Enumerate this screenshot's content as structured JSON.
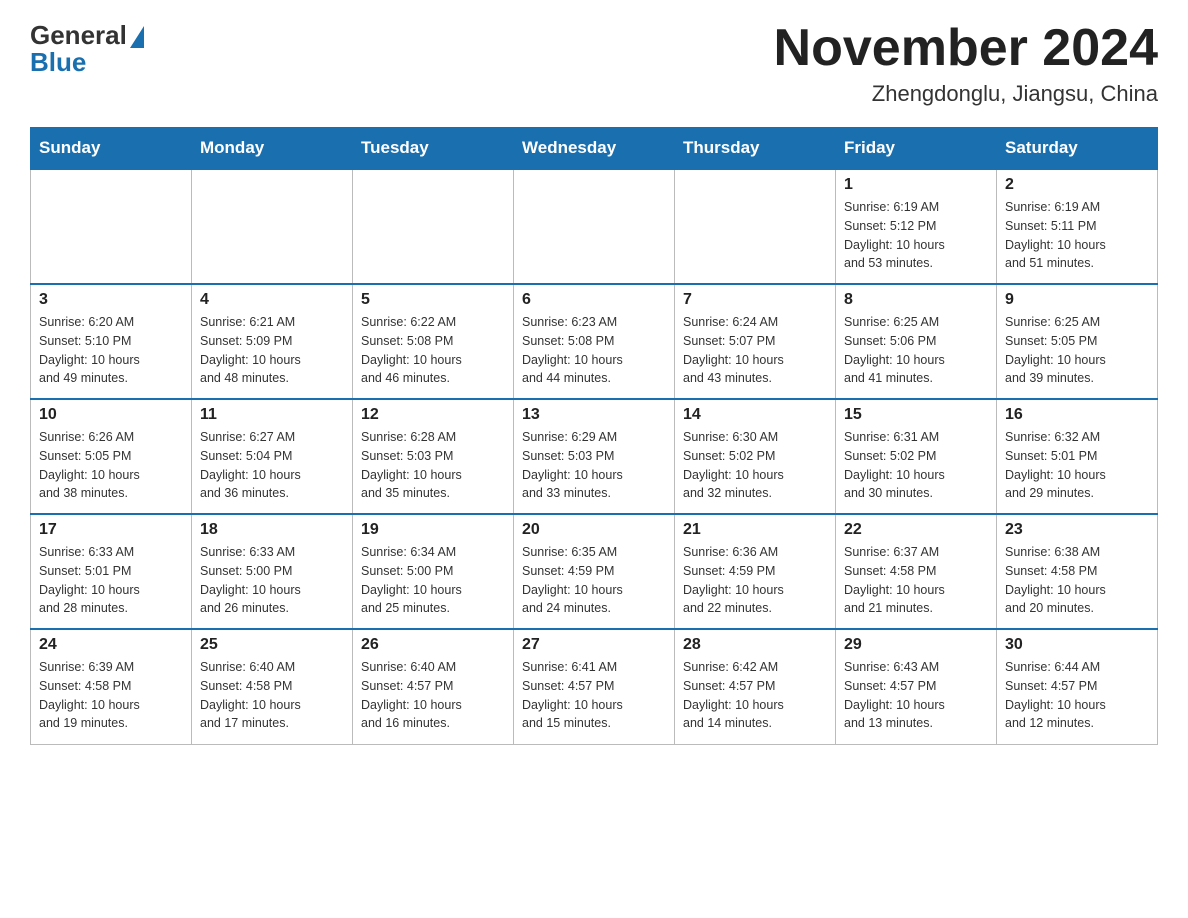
{
  "header": {
    "logo_general": "General",
    "logo_blue": "Blue",
    "month_title": "November 2024",
    "location": "Zhengdonglu, Jiangsu, China"
  },
  "days_of_week": [
    "Sunday",
    "Monday",
    "Tuesday",
    "Wednesday",
    "Thursday",
    "Friday",
    "Saturday"
  ],
  "weeks": [
    [
      {
        "day": "",
        "info": ""
      },
      {
        "day": "",
        "info": ""
      },
      {
        "day": "",
        "info": ""
      },
      {
        "day": "",
        "info": ""
      },
      {
        "day": "",
        "info": ""
      },
      {
        "day": "1",
        "info": "Sunrise: 6:19 AM\nSunset: 5:12 PM\nDaylight: 10 hours\nand 53 minutes."
      },
      {
        "day": "2",
        "info": "Sunrise: 6:19 AM\nSunset: 5:11 PM\nDaylight: 10 hours\nand 51 minutes."
      }
    ],
    [
      {
        "day": "3",
        "info": "Sunrise: 6:20 AM\nSunset: 5:10 PM\nDaylight: 10 hours\nand 49 minutes."
      },
      {
        "day": "4",
        "info": "Sunrise: 6:21 AM\nSunset: 5:09 PM\nDaylight: 10 hours\nand 48 minutes."
      },
      {
        "day": "5",
        "info": "Sunrise: 6:22 AM\nSunset: 5:08 PM\nDaylight: 10 hours\nand 46 minutes."
      },
      {
        "day": "6",
        "info": "Sunrise: 6:23 AM\nSunset: 5:08 PM\nDaylight: 10 hours\nand 44 minutes."
      },
      {
        "day": "7",
        "info": "Sunrise: 6:24 AM\nSunset: 5:07 PM\nDaylight: 10 hours\nand 43 minutes."
      },
      {
        "day": "8",
        "info": "Sunrise: 6:25 AM\nSunset: 5:06 PM\nDaylight: 10 hours\nand 41 minutes."
      },
      {
        "day": "9",
        "info": "Sunrise: 6:25 AM\nSunset: 5:05 PM\nDaylight: 10 hours\nand 39 minutes."
      }
    ],
    [
      {
        "day": "10",
        "info": "Sunrise: 6:26 AM\nSunset: 5:05 PM\nDaylight: 10 hours\nand 38 minutes."
      },
      {
        "day": "11",
        "info": "Sunrise: 6:27 AM\nSunset: 5:04 PM\nDaylight: 10 hours\nand 36 minutes."
      },
      {
        "day": "12",
        "info": "Sunrise: 6:28 AM\nSunset: 5:03 PM\nDaylight: 10 hours\nand 35 minutes."
      },
      {
        "day": "13",
        "info": "Sunrise: 6:29 AM\nSunset: 5:03 PM\nDaylight: 10 hours\nand 33 minutes."
      },
      {
        "day": "14",
        "info": "Sunrise: 6:30 AM\nSunset: 5:02 PM\nDaylight: 10 hours\nand 32 minutes."
      },
      {
        "day": "15",
        "info": "Sunrise: 6:31 AM\nSunset: 5:02 PM\nDaylight: 10 hours\nand 30 minutes."
      },
      {
        "day": "16",
        "info": "Sunrise: 6:32 AM\nSunset: 5:01 PM\nDaylight: 10 hours\nand 29 minutes."
      }
    ],
    [
      {
        "day": "17",
        "info": "Sunrise: 6:33 AM\nSunset: 5:01 PM\nDaylight: 10 hours\nand 28 minutes."
      },
      {
        "day": "18",
        "info": "Sunrise: 6:33 AM\nSunset: 5:00 PM\nDaylight: 10 hours\nand 26 minutes."
      },
      {
        "day": "19",
        "info": "Sunrise: 6:34 AM\nSunset: 5:00 PM\nDaylight: 10 hours\nand 25 minutes."
      },
      {
        "day": "20",
        "info": "Sunrise: 6:35 AM\nSunset: 4:59 PM\nDaylight: 10 hours\nand 24 minutes."
      },
      {
        "day": "21",
        "info": "Sunrise: 6:36 AM\nSunset: 4:59 PM\nDaylight: 10 hours\nand 22 minutes."
      },
      {
        "day": "22",
        "info": "Sunrise: 6:37 AM\nSunset: 4:58 PM\nDaylight: 10 hours\nand 21 minutes."
      },
      {
        "day": "23",
        "info": "Sunrise: 6:38 AM\nSunset: 4:58 PM\nDaylight: 10 hours\nand 20 minutes."
      }
    ],
    [
      {
        "day": "24",
        "info": "Sunrise: 6:39 AM\nSunset: 4:58 PM\nDaylight: 10 hours\nand 19 minutes."
      },
      {
        "day": "25",
        "info": "Sunrise: 6:40 AM\nSunset: 4:58 PM\nDaylight: 10 hours\nand 17 minutes."
      },
      {
        "day": "26",
        "info": "Sunrise: 6:40 AM\nSunset: 4:57 PM\nDaylight: 10 hours\nand 16 minutes."
      },
      {
        "day": "27",
        "info": "Sunrise: 6:41 AM\nSunset: 4:57 PM\nDaylight: 10 hours\nand 15 minutes."
      },
      {
        "day": "28",
        "info": "Sunrise: 6:42 AM\nSunset: 4:57 PM\nDaylight: 10 hours\nand 14 minutes."
      },
      {
        "day": "29",
        "info": "Sunrise: 6:43 AM\nSunset: 4:57 PM\nDaylight: 10 hours\nand 13 minutes."
      },
      {
        "day": "30",
        "info": "Sunrise: 6:44 AM\nSunset: 4:57 PM\nDaylight: 10 hours\nand 12 minutes."
      }
    ]
  ]
}
